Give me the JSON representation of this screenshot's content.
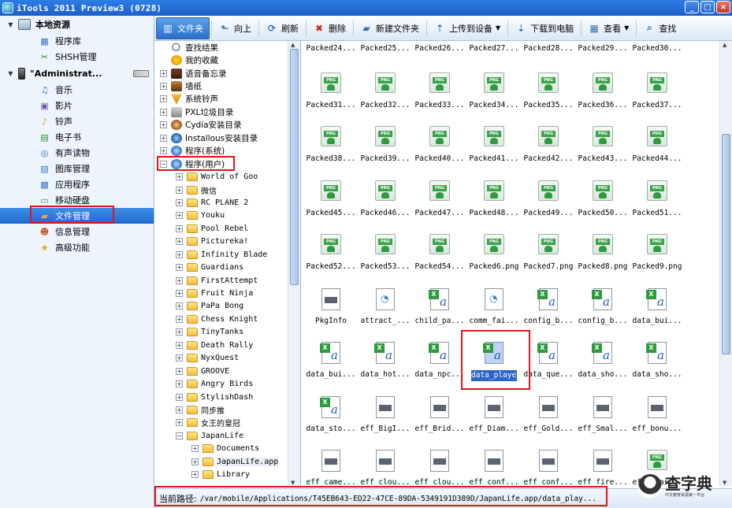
{
  "window": {
    "title": "iTools 2011 Preview3 (0728)",
    "buttons": [
      "_",
      "□",
      "×"
    ]
  },
  "leftnav": {
    "local_group": "本地资源",
    "local_items": [
      {
        "label": "程序库",
        "icon": "app-library-icon",
        "glyph": "▦",
        "color": "#3a6fc4"
      },
      {
        "label": "SHSH管理",
        "icon": "shsh-icon",
        "glyph": "✂",
        "color": "#2e8c3a"
      }
    ],
    "device_group": "\"Administrat...",
    "device_items": [
      {
        "label": "音乐",
        "icon": "music-icon",
        "glyph": "♫",
        "color": "#2d6fbf"
      },
      {
        "label": "影片",
        "icon": "movie-icon",
        "glyph": "▣",
        "color": "#6a5aa8"
      },
      {
        "label": "铃声",
        "icon": "ringtone-icon",
        "glyph": "♪",
        "color": "#d89a1a"
      },
      {
        "label": "电子书",
        "icon": "ebook-icon",
        "glyph": "▤",
        "color": "#2e8c3a"
      },
      {
        "label": "有声读物",
        "icon": "audiobook-icon",
        "glyph": "◎",
        "color": "#2d6fbf"
      },
      {
        "label": "图库管理",
        "icon": "photo-icon",
        "glyph": "▧",
        "color": "#3a77c8"
      },
      {
        "label": "应用程序",
        "icon": "app-icon",
        "glyph": "▩",
        "color": "#3a77c8"
      },
      {
        "label": "移动硬盘",
        "icon": "disk-icon",
        "glyph": "▭",
        "color": "#777777"
      },
      {
        "label": "文件管理",
        "icon": "folder-icon",
        "glyph": "▰",
        "color": "#e8b030"
      },
      {
        "label": "信息管理",
        "icon": "contacts-icon",
        "glyph": "☻",
        "color": "#c85a2a"
      },
      {
        "label": "高级功能",
        "icon": "star-icon",
        "glyph": "★",
        "color": "#e0a800"
      }
    ],
    "selected_index": 8
  },
  "toolbar": {
    "items": [
      {
        "label": "文件夹",
        "icon": "folder-view-icon",
        "glyph": "▥",
        "active": true
      },
      {
        "label": "向上",
        "icon": "up-icon",
        "glyph": "⬑"
      },
      {
        "label": "刷新",
        "icon": "refresh-icon",
        "glyph": "⟳"
      },
      {
        "label": "删除",
        "icon": "delete-icon",
        "glyph": "✖"
      },
      {
        "label": "新建文件夹",
        "icon": "new-folder-icon",
        "glyph": "▰"
      },
      {
        "label": "上传到设备",
        "icon": "upload-icon",
        "glyph": "⇡",
        "dropdown": true
      },
      {
        "label": "下载到电脑",
        "icon": "download-icon",
        "glyph": "⇣"
      },
      {
        "label": "查看",
        "icon": "view-icon",
        "glyph": "▦",
        "dropdown": true
      },
      {
        "label": "查找",
        "icon": "search-icon",
        "glyph": "⌕"
      }
    ]
  },
  "tree": {
    "rows": [
      {
        "label": "查找结果",
        "level": 0,
        "exp": "",
        "icon": "search-icon"
      },
      {
        "label": "我的收藏",
        "level": 0,
        "exp": "",
        "icon": "star-icon"
      },
      {
        "label": "语音备忘录",
        "level": 0,
        "exp": "+",
        "icon": "voice-memo-icon"
      },
      {
        "label": "墙纸",
        "level": 0,
        "exp": "+",
        "icon": "wallpaper-icon"
      },
      {
        "label": "系统铃声",
        "level": 0,
        "exp": "+",
        "icon": "ringtone-icon"
      },
      {
        "label": "PXL垃圾目录",
        "level": 0,
        "exp": "+",
        "icon": "trash-icon"
      },
      {
        "label": "Cydia安装目录",
        "level": 0,
        "exp": "+",
        "icon": "cydia-icon"
      },
      {
        "label": "Installous安装目录",
        "level": 0,
        "exp": "+",
        "icon": "installous-icon"
      },
      {
        "label": "程序(系统)",
        "level": 0,
        "exp": "+",
        "icon": "app-store-icon"
      },
      {
        "label": "程序(用户)",
        "level": 0,
        "exp": "−",
        "icon": "app-store-icon"
      },
      {
        "label": "World of Goo",
        "level": 1,
        "exp": "+",
        "icon": "folder-icon"
      },
      {
        "label": "微信",
        "level": 1,
        "exp": "+",
        "icon": "folder-icon"
      },
      {
        "label": "RC PLANE 2",
        "level": 1,
        "exp": "+",
        "icon": "folder-icon"
      },
      {
        "label": "Youku",
        "level": 1,
        "exp": "+",
        "icon": "folder-icon"
      },
      {
        "label": "Pool Rebel",
        "level": 1,
        "exp": "+",
        "icon": "folder-icon"
      },
      {
        "label": "Pictureka!",
        "level": 1,
        "exp": "+",
        "icon": "folder-icon"
      },
      {
        "label": "Infinity Blade",
        "level": 1,
        "exp": "+",
        "icon": "folder-icon"
      },
      {
        "label": "Guardians",
        "level": 1,
        "exp": "+",
        "icon": "folder-icon"
      },
      {
        "label": "FirstAttempt",
        "level": 1,
        "exp": "+",
        "icon": "folder-icon"
      },
      {
        "label": "Fruit Ninja",
        "level": 1,
        "exp": "+",
        "icon": "folder-icon"
      },
      {
        "label": "PaPa Bong",
        "level": 1,
        "exp": "+",
        "icon": "folder-icon"
      },
      {
        "label": "Chess Knight",
        "level": 1,
        "exp": "+",
        "icon": "folder-icon"
      },
      {
        "label": "TinyTanks",
        "level": 1,
        "exp": "+",
        "icon": "folder-icon"
      },
      {
        "label": "Death Rally",
        "level": 1,
        "exp": "+",
        "icon": "folder-icon"
      },
      {
        "label": "NyxQuest",
        "level": 1,
        "exp": "+",
        "icon": "folder-icon"
      },
      {
        "label": "GROOVE",
        "level": 1,
        "exp": "+",
        "icon": "folder-icon"
      },
      {
        "label": "Angry Birds",
        "level": 1,
        "exp": "+",
        "icon": "folder-icon"
      },
      {
        "label": "StylishDash",
        "level": 1,
        "exp": "+",
        "icon": "folder-icon"
      },
      {
        "label": "同步推",
        "level": 1,
        "exp": "+",
        "icon": "folder-icon"
      },
      {
        "label": "女王的皇冠",
        "level": 1,
        "exp": "+",
        "icon": "folder-icon"
      },
      {
        "label": "JapanLife",
        "level": 1,
        "exp": "−",
        "icon": "folder-icon"
      },
      {
        "label": "Documents",
        "level": 2,
        "exp": "+",
        "icon": "folder-icon"
      },
      {
        "label": "JapanLife.app",
        "level": 2,
        "exp": "+",
        "icon": "folder-icon",
        "highlight": true
      },
      {
        "label": "Library",
        "level": 2,
        "exp": "+",
        "icon": "folder-icon"
      }
    ]
  },
  "files": {
    "rows": [
      [
        {
          "n": "Packed24...",
          "t": "png",
          "partial": true
        },
        {
          "n": "Packed25...",
          "t": "png",
          "partial": true
        },
        {
          "n": "Packed26...",
          "t": "png",
          "partial": true
        },
        {
          "n": "Packed27...",
          "t": "png",
          "partial": true
        },
        {
          "n": "Packed28...",
          "t": "png",
          "partial": true
        },
        {
          "n": "Packed29...",
          "t": "png",
          "partial": true
        },
        {
          "n": "Packed30...",
          "t": "png",
          "partial": true
        }
      ],
      [
        {
          "n": "Packed31...",
          "t": "png"
        },
        {
          "n": "Packed32...",
          "t": "png"
        },
        {
          "n": "Packed33...",
          "t": "png"
        },
        {
          "n": "Packed34...",
          "t": "png"
        },
        {
          "n": "Packed35...",
          "t": "png"
        },
        {
          "n": "Packed36...",
          "t": "png"
        },
        {
          "n": "Packed37...",
          "t": "png"
        }
      ],
      [
        {
          "n": "Packed38...",
          "t": "png"
        },
        {
          "n": "Packed39...",
          "t": "png"
        },
        {
          "n": "Packed40...",
          "t": "png"
        },
        {
          "n": "Packed41...",
          "t": "png"
        },
        {
          "n": "Packed42...",
          "t": "png"
        },
        {
          "n": "Packed43...",
          "t": "png"
        },
        {
          "n": "Packed44...",
          "t": "png"
        }
      ],
      [
        {
          "n": "Packed45...",
          "t": "png"
        },
        {
          "n": "Packed46...",
          "t": "png"
        },
        {
          "n": "Packed47...",
          "t": "png"
        },
        {
          "n": "Packed48...",
          "t": "png"
        },
        {
          "n": "Packed49...",
          "t": "png"
        },
        {
          "n": "Packed50...",
          "t": "png"
        },
        {
          "n": "Packed51...",
          "t": "png"
        }
      ],
      [
        {
          "n": "Packed52...",
          "t": "png"
        },
        {
          "n": "Packed53...",
          "t": "png"
        },
        {
          "n": "Packed54...",
          "t": "png"
        },
        {
          "n": "Packed6.png",
          "t": "png"
        },
        {
          "n": "Packed7.png",
          "t": "png"
        },
        {
          "n": "Packed8.png",
          "t": "png"
        },
        {
          "n": "Packed9.png",
          "t": "png"
        }
      ],
      [
        {
          "n": "PkgInfo",
          "t": "doc"
        },
        {
          "n": "attract_...",
          "t": "audio"
        },
        {
          "n": "child_pa...",
          "t": "xls"
        },
        {
          "n": "comm_fai...",
          "t": "audio"
        },
        {
          "n": "config_b...",
          "t": "xls"
        },
        {
          "n": "config_b...",
          "t": "xls"
        },
        {
          "n": "data_bui...",
          "t": "xls"
        }
      ],
      [
        {
          "n": "data_bui...",
          "t": "xls"
        },
        {
          "n": "data_hot...",
          "t": "xls"
        },
        {
          "n": "data_npc...",
          "t": "xls"
        },
        {
          "n": "data_player.csv",
          "t": "xls",
          "selected": true
        },
        {
          "n": "data_que...",
          "t": "xls"
        },
        {
          "n": "data_sho...",
          "t": "xls"
        },
        {
          "n": "data_sho...",
          "t": "xls"
        }
      ],
      [
        {
          "n": "data_sto...",
          "t": "xls"
        },
        {
          "n": "eff_BigI...",
          "t": "doc"
        },
        {
          "n": "eff_Brid...",
          "t": "doc"
        },
        {
          "n": "eff_Diam...",
          "t": "doc"
        },
        {
          "n": "eff_Gold...",
          "t": "doc"
        },
        {
          "n": "eff_Smal...",
          "t": "doc"
        },
        {
          "n": "eff_bonu...",
          "t": "doc"
        }
      ],
      [
        {
          "n": "eff_came...",
          "t": "doc"
        },
        {
          "n": "eff_clou...",
          "t": "doc"
        },
        {
          "n": "eff_clou...",
          "t": "doc"
        },
        {
          "n": "eff_conf...",
          "t": "doc"
        },
        {
          "n": "eff_conf...",
          "t": "doc"
        },
        {
          "n": "eff_fire...",
          "t": "doc"
        },
        {
          "n": "eff_flas...",
          "t": "png"
        }
      ]
    ]
  },
  "status": {
    "label": "当前路径:",
    "path": "/var/mobile/Applications/T45EB643-ED22-47CE-89DA-5349191D389D/JapanLife.app/data_play..."
  },
  "watermark": {
    "brand": "查字典",
    "sub": "中文教育资源第一平台"
  },
  "colors": {
    "accent": "#2d64c8",
    "highlight_box": "#e0141b"
  }
}
